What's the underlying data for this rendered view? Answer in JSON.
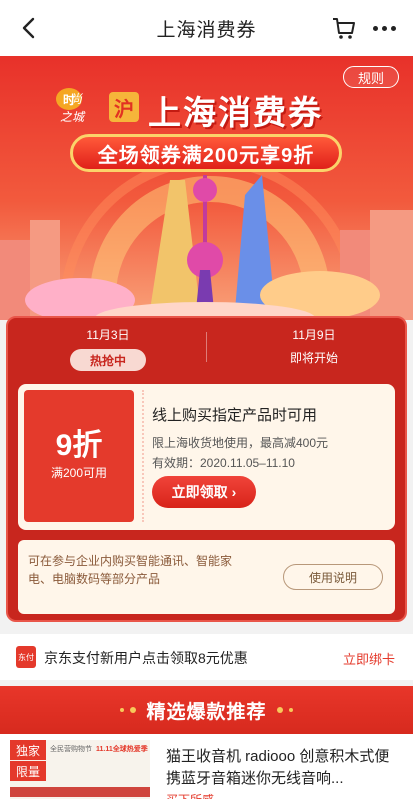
{
  "nav": {
    "title": "上海消费券"
  },
  "hero": {
    "rules": "规则",
    "brand_line1": "时",
    "brand_line2": "尚",
    "brand_line3": "之城",
    "hu": "沪",
    "title": "上海消费券",
    "slogan": "全场领券满200元享9折"
  },
  "tabs": [
    {
      "date": "11月3日",
      "status": "热抢中"
    },
    {
      "date": "11月9日",
      "status": "即将开始"
    }
  ],
  "coupon": {
    "discount": "9折",
    "condition": "满200可用",
    "title": "线上购买指定产品时可用",
    "desc": "限上海收货地使用，最高减400元",
    "valid": "有效期：2020.11.05–11.10",
    "claim": "立即领取",
    "claim_arrow": "›"
  },
  "notes": {
    "text": "可在参与企业内购买智能通讯、智能家电、电脑数码等部分产品",
    "usage": "使用说明"
  },
  "pay": {
    "icon_text": "东付",
    "text": "京东支付新用户点击领取8元优惠",
    "link": "立即绑卡"
  },
  "recommend": {
    "title": "精选爆款推荐"
  },
  "product": {
    "tag1": "独家",
    "tag2": "限量",
    "brand": "全民营购物节",
    "brand2": "11.11全球热爱季",
    "title": "猫王收音机 radiooo 创意积木式便携蓝牙音箱迷你无线音响...",
    "sub": "买下所感"
  },
  "colors": {
    "accent": "#e4392b",
    "panel": "#c8261e",
    "gold": "#f7c95a"
  }
}
